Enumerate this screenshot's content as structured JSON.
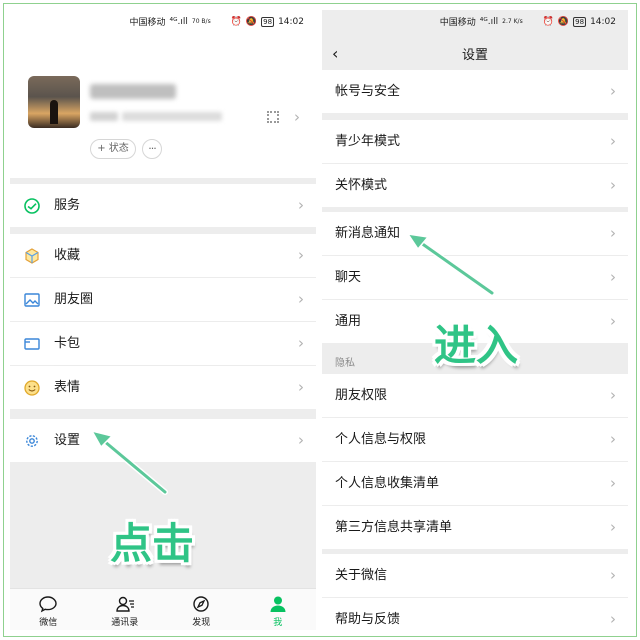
{
  "status_bar": {
    "carrier": "中国移动",
    "signal": "⁴ᴳ.ıll",
    "speed_left": "70 B/s",
    "speed_right": "2.7 K/s",
    "battery": "98",
    "time": "14:02"
  },
  "me_page": {
    "status_pill": "+ 状态",
    "more_pill": "···",
    "menu": [
      {
        "label": "服务"
      },
      {
        "label": "收藏"
      },
      {
        "label": "朋友圈"
      },
      {
        "label": "卡包"
      },
      {
        "label": "表情"
      },
      {
        "label": "设置"
      }
    ],
    "tabs": [
      {
        "label": "微信"
      },
      {
        "label": "通讯录"
      },
      {
        "label": "发现"
      },
      {
        "label": "我"
      }
    ],
    "overlay_text": "点击"
  },
  "settings_page": {
    "back": "‹",
    "title": "设置",
    "rows": [
      "帐号与安全",
      "青少年模式",
      "关怀模式",
      "新消息通知",
      "聊天",
      "通用",
      "朋友权限",
      "个人信息与权限",
      "个人信息收集清单",
      "第三方信息共享清单",
      "关于微信",
      "帮助与反馈"
    ],
    "section_privacy": "隐私",
    "overlay_text": "进入"
  },
  "chevron": "›",
  "colors": {
    "accent": "#07c160",
    "annotation": "#2fc486"
  }
}
